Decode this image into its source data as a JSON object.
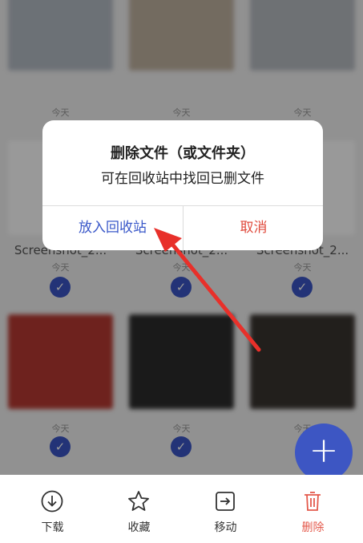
{
  "grid": {
    "rows": [
      {
        "cells": [
          {
            "name": "",
            "date": "今天"
          },
          {
            "name": "",
            "date": "今天"
          },
          {
            "name": "",
            "date": "今天"
          }
        ],
        "thumb_colors": [
          "#b5bcc5",
          "#c0b2a0",
          "#b8bcc2"
        ]
      },
      {
        "cells": [
          {
            "name": "Screenshot_2...",
            "date": "今天"
          },
          {
            "name": "Screenshot_2...",
            "date": "今天"
          },
          {
            "name": "Screenshot_2...",
            "date": "今天"
          }
        ],
        "thumb_colors": [
          "#ffffff",
          "#ffffff",
          "#ffffff"
        ]
      },
      {
        "cells": [
          {
            "name": "",
            "date": "今天"
          },
          {
            "name": "",
            "date": "今天"
          },
          {
            "name": "",
            "date": "今天"
          }
        ],
        "thumb_colors": [
          "#b83a32",
          "#2c2c2c",
          "#3a3430"
        ]
      }
    ]
  },
  "fab": {
    "label": "+"
  },
  "dialog": {
    "title": "删除文件（或文件夹）",
    "message": "可在回收站中找回已删文件",
    "confirm_label": "放入回收站",
    "cancel_label": "取消",
    "confirm_color": "#3a58c9",
    "cancel_color": "#e04a3c"
  },
  "toolbar": {
    "items": [
      {
        "label": "下载",
        "icon": "download-icon"
      },
      {
        "label": "收藏",
        "icon": "star-icon"
      },
      {
        "label": "移动",
        "icon": "move-icon"
      },
      {
        "label": "删除",
        "icon": "trash-icon"
      }
    ]
  },
  "colors": {
    "accent": "#3b55c7",
    "danger": "#e45a4c",
    "arrow": "#e8302a"
  }
}
